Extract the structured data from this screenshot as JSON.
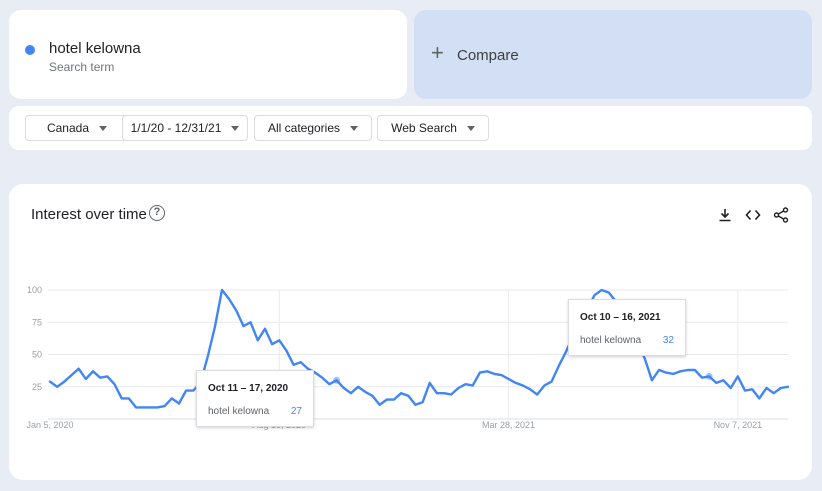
{
  "search_term": {
    "name": "hotel kelowna",
    "subtitle": "Search term",
    "color": "#4285f4"
  },
  "compare": {
    "label": "Compare",
    "icon": "plus-icon"
  },
  "filters": {
    "region": "Canada",
    "date_range": "1/1/20 - 12/31/21",
    "category": "All categories",
    "search_type": "Web Search"
  },
  "chart": {
    "title": "Interest over time",
    "icons": [
      "help-icon",
      "download-icon",
      "embed-icon",
      "share-icon"
    ]
  },
  "tooltips": [
    {
      "date": "Oct 11 – 17, 2020",
      "term": "hotel kelowna",
      "value": "27"
    },
    {
      "date": "Oct 10 – 16, 2021",
      "term": "hotel kelowna",
      "value": "32"
    }
  ],
  "chart_data": {
    "type": "line",
    "title": "Interest over time",
    "ylim": [
      0,
      100
    ],
    "y_ticks": [
      "100",
      "75",
      "50",
      "25"
    ],
    "x_ticks": [
      "Jan 5, 2020",
      "Aug 16, 2020",
      "Mar 28, 2021",
      "Nov 7, 2021"
    ],
    "grid": true,
    "series": [
      {
        "name": "hotel kelowna",
        "color": "#4285f4",
        "x": [
          "2020-01-05",
          "2020-01-12",
          "2020-01-19",
          "2020-01-26",
          "2020-02-02",
          "2020-02-09",
          "2020-02-16",
          "2020-02-23",
          "2020-03-01",
          "2020-03-08",
          "2020-03-15",
          "2020-03-22",
          "2020-03-29",
          "2020-04-05",
          "2020-04-12",
          "2020-04-19",
          "2020-04-26",
          "2020-05-03",
          "2020-05-10",
          "2020-05-17",
          "2020-05-24",
          "2020-05-31",
          "2020-06-07",
          "2020-06-14",
          "2020-06-21",
          "2020-06-28",
          "2020-07-05",
          "2020-07-12",
          "2020-07-19",
          "2020-07-26",
          "2020-08-02",
          "2020-08-09",
          "2020-08-16",
          "2020-08-23",
          "2020-08-30",
          "2020-09-06",
          "2020-09-13",
          "2020-09-20",
          "2020-09-27",
          "2020-10-04",
          "2020-10-11",
          "2020-10-18",
          "2020-10-25",
          "2020-11-01",
          "2020-11-08",
          "2020-11-15",
          "2020-11-22",
          "2020-11-29",
          "2020-12-06",
          "2020-12-13",
          "2020-12-20",
          "2020-12-27",
          "2021-01-03",
          "2021-01-10",
          "2021-01-17",
          "2021-01-24",
          "2021-01-31",
          "2021-02-07",
          "2021-02-14",
          "2021-02-21",
          "2021-02-28",
          "2021-03-07",
          "2021-03-14",
          "2021-03-21",
          "2021-03-28",
          "2021-04-04",
          "2021-04-11",
          "2021-04-18",
          "2021-04-25",
          "2021-05-02",
          "2021-05-09",
          "2021-05-16",
          "2021-05-23",
          "2021-05-30",
          "2021-06-06",
          "2021-06-13",
          "2021-06-20",
          "2021-06-27",
          "2021-07-04",
          "2021-07-11",
          "2021-07-18",
          "2021-07-25",
          "2021-08-01",
          "2021-08-08",
          "2021-08-15",
          "2021-08-22",
          "2021-08-29",
          "2021-09-05",
          "2021-09-12",
          "2021-09-19",
          "2021-09-26",
          "2021-10-03",
          "2021-10-10",
          "2021-10-17",
          "2021-10-24",
          "2021-10-31",
          "2021-11-07",
          "2021-11-14",
          "2021-11-21",
          "2021-11-28",
          "2021-12-05",
          "2021-12-12",
          "2021-12-19",
          "2021-12-26"
        ],
        "values": [
          29,
          25,
          29,
          34,
          39,
          31,
          37,
          32,
          33,
          27,
          16,
          16,
          9,
          9,
          9,
          9,
          10,
          16,
          12,
          22,
          22,
          28,
          48,
          71,
          100,
          93,
          84,
          72,
          75,
          61,
          70,
          58,
          61,
          53,
          42,
          44,
          39,
          36,
          32,
          27,
          30,
          24,
          20,
          25,
          21,
          18,
          11,
          15,
          15,
          20,
          18,
          11,
          13,
          28,
          20,
          20,
          19,
          24,
          27,
          26,
          36,
          37,
          35,
          34,
          31,
          28,
          26,
          23,
          19,
          26,
          29,
          41,
          52,
          64,
          78,
          85,
          96,
          100,
          98,
          91,
          83,
          69,
          59,
          47,
          30,
          38,
          36,
          35,
          37,
          38,
          38,
          32,
          33,
          28,
          30,
          24,
          33,
          22,
          23,
          16,
          24,
          20,
          24,
          25
        ]
      }
    ]
  }
}
